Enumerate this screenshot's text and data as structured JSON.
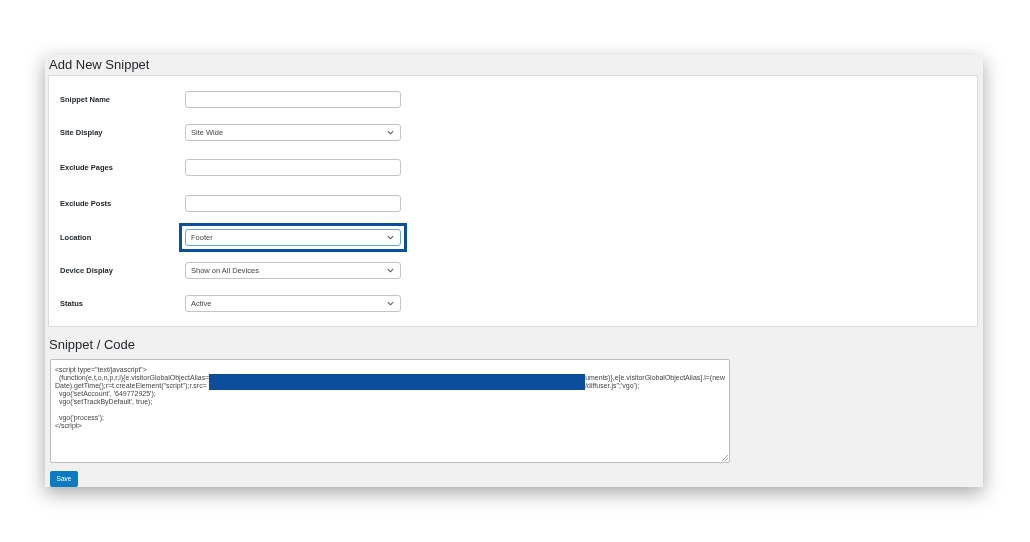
{
  "title": "Add New Snippet",
  "fields": [
    {
      "label": "Snippet Name",
      "kind": "text",
      "highlighted": false
    },
    {
      "label": "Site Display",
      "kind": "select",
      "value": "Site Wide",
      "highlighted": false
    },
    {
      "label": "Exclude Pages",
      "kind": "text",
      "highlighted": false
    },
    {
      "label": "Exclude Posts",
      "kind": "text",
      "highlighted": false
    },
    {
      "label": "Location",
      "kind": "select",
      "value": "Footer",
      "highlighted": true
    },
    {
      "label": "Device Display",
      "kind": "select",
      "value": "Show on All Devices",
      "highlighted": false
    },
    {
      "label": "Status",
      "kind": "select",
      "value": "Active",
      "highlighted": false
    }
  ],
  "code_heading": "Snippet / Code",
  "code": {
    "lines_before": [
      "<script type=\"text/javascript\">"
    ],
    "redacted": true,
    "redacted_rows": [
      {
        "before": "  (function(e,t,o,n,p,r,i){e.visitorGlobalObjectAlias=",
        "after": "uments)},e[e.visitorGlobalObjectAlias].l=(new"
      },
      {
        "before": "Date).getTime();r=t.createElement(\"script\");r.src=",
        "after": "/diffuser.js\";'vgo');"
      }
    ],
    "line_groups_after": [
      [
        "  vgo('setAccount', '649772925');",
        "  vgo('setTrackByDefault', true);"
      ],
      [
        "  vgo('process');",
        "</script>"
      ]
    ]
  },
  "save_button": "Save"
}
